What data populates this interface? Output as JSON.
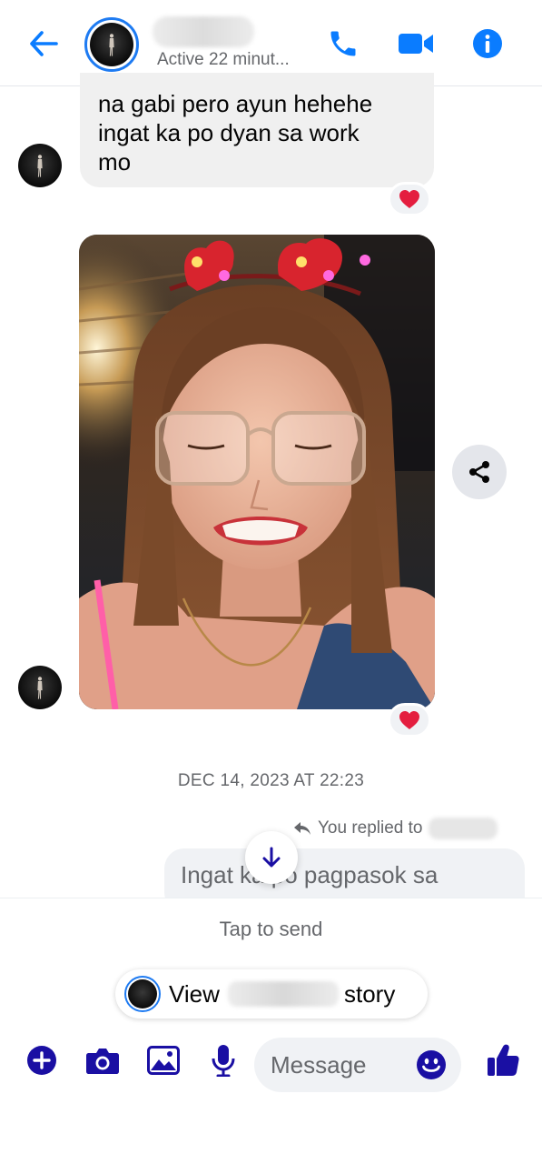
{
  "header": {
    "status": "Active 22 minut..."
  },
  "messages": {
    "top_bubble_lines": [
      "na gabi pero ayun hehehe",
      "ingat ka po dyan sa work",
      "mo"
    ],
    "top_reaction": "❤️",
    "photo_reaction": "❤️",
    "timestamp": "DEC 14, 2023 AT 22:23",
    "replied_label": "You replied to",
    "reply_bubble_text": "Ingat ka po pagpasok sa"
  },
  "composer": {
    "tap_to_send": "Tap to send",
    "view_story_prefix": "View",
    "view_story_suffix": "story",
    "message_placeholder": "Message"
  },
  "colors": {
    "accent": "#0a7cff",
    "deep_blue": "#1a0fa3",
    "bubble_gray": "#f0f0f0",
    "secondary_text": "#65676b",
    "heart": "#e41e3f"
  },
  "icons": [
    "back-arrow-icon",
    "phone-icon",
    "video-camera-icon",
    "info-icon",
    "share-icon",
    "arrow-down-icon",
    "plus-icon",
    "camera-icon",
    "gallery-icon",
    "microphone-icon",
    "emoji-icon",
    "thumbs-up-icon",
    "reply-arrow-icon",
    "heart-icon"
  ]
}
